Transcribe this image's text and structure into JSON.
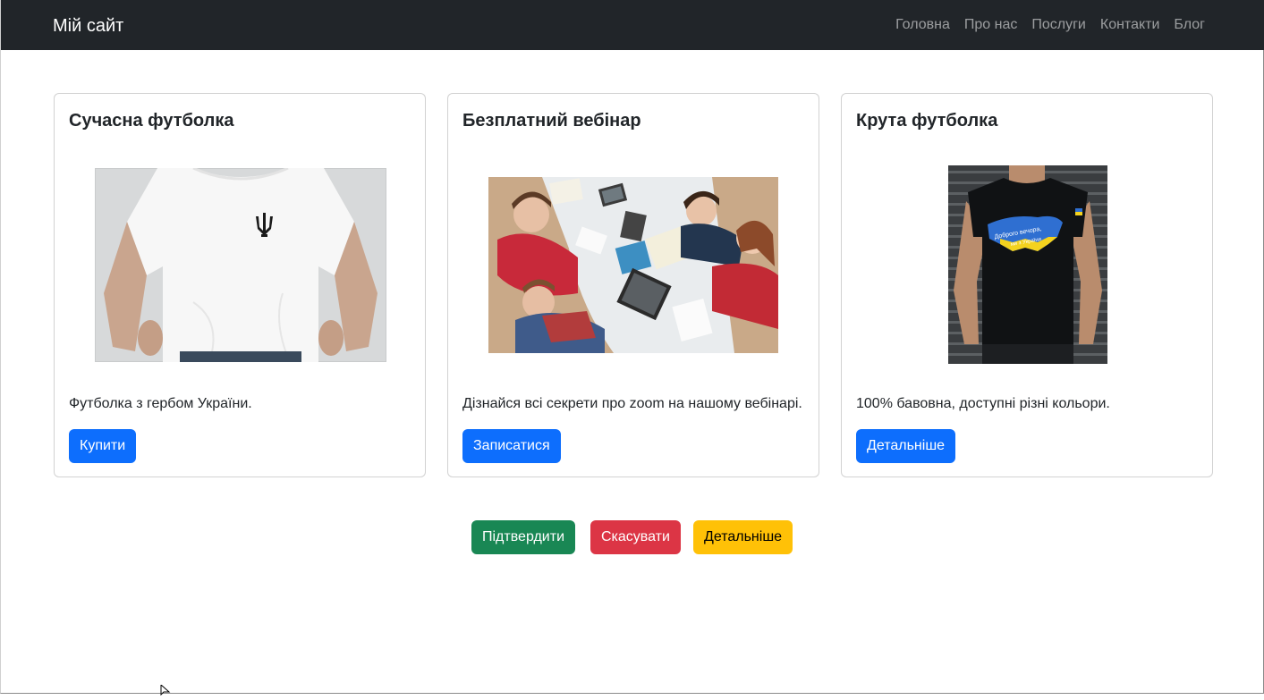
{
  "navbar": {
    "brand": "Мій сайт",
    "links": [
      "Головна",
      "Про нас",
      "Послуги",
      "Контакти",
      "Блог"
    ]
  },
  "cards": [
    {
      "title": "Сучасна футболка",
      "text": "Футболка з гербом України.",
      "button": "Купити",
      "image": "white-tshirt-trident"
    },
    {
      "title": "Безплатний вебінар",
      "text": "Дізнайся всі секрети про zoom на нашому вебінарі.",
      "button": "Записатися",
      "image": "students-at-table"
    },
    {
      "title": "Крута футболка",
      "text": "100% бавовна, доступні різні кольори.",
      "button": "Детальніше",
      "image": "black-tshirt-ukraine-map",
      "image_caption": "Доброго вечора, ми з України"
    }
  ],
  "actions": {
    "confirm": "Підтвердити",
    "cancel": "Скасувати",
    "details": "Детальніше"
  },
  "colors": {
    "navbar_bg": "#212529",
    "primary": "#0d6efd",
    "success": "#198754",
    "danger": "#dc3545",
    "warning": "#ffc107"
  }
}
